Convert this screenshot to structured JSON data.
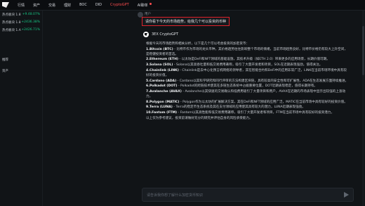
{
  "nav": {
    "items": [
      "行情",
      "资产",
      "交易",
      "理财",
      "BOC",
      "DID",
      "CryptoGPT",
      "AI聊单"
    ],
    "active": "CryptoGPT"
  },
  "sidebar": {
    "tickers": [
      {
        "name": "热点板块 1.8",
        "pct": "+9.48.07%"
      },
      {
        "name": "热点板块 1.8",
        "pct": "+2436.38%"
      },
      {
        "name": "热点板块 1.A",
        "pct": "+2426.71%"
      }
    ],
    "section_a": "推荐",
    "section_b": "资产"
  },
  "chat": {
    "user": {
      "name": "用户",
      "message": "请你看下今天的市场趋势，给我几个可以投资的币种"
    },
    "bot": {
      "name": "3EX CryptoGPT",
      "intro": "根据今天的市场趋势和相关分析，以下是几个可以考虑投资的加密货币：",
      "items": [
        {
          "title": "1.Bitcoin (BTC)",
          "text": " - 比特币作为市场的龙头币种，其价格趋势往往影响整个市场的情绪，当前市场趋势良好，比特币价格仍有较大上升空间，是稳健投资者的首选。"
        },
        {
          "title": "2.Ethereum (ETH)",
          "text": " - 以太坊是DeFi和NFT领域的基础设施，其技术升级（如ETH 2.0）带来更多的应用场景，长期价值可期。"
        },
        {
          "title": "3.Solana (SOL)",
          "text": " - Solana以其高吞吐量和低交易费用著称，吸引了大量开发者和项目，SOL在近期表现强劲，值得关注。"
        },
        {
          "title": "4.Chainlink (LINK)",
          "text": " - Chainlink是去中心化预言机网络的领导者，其在智能合约和DeFi中的应用非常广泛，LINK在当前市场环境中具有较好的投资价值。"
        },
        {
          "title": "5.Cardano (ADA)",
          "text": " - Cardano以其科学研究和同行评审的方法构建区块链，具有较高的安全性和可扩展性，ADA在生态发展方面持续推进。"
        },
        {
          "title": "6.Polkadot (DOT)",
          "text": " - Polkadot的跨链技术使其在多链生态系统中占据重要位置，DOT近期表现稳定，值得长期持有。"
        },
        {
          "title": "7.Avalanche (AVAX)",
          "text": " - Avalanche以其快速的交易确认和低费用吸引了大量项目和用户，AVAX在近期的市场表现中显示出较强的上涨动力。"
        },
        {
          "title": "8.Polygon (MATIC)",
          "text": " - Polygon作为以太坊的扩展解决方案，其在DeFi和NFT领域的应用广泛，MATIC在当前市场中具有较好的投资价值。"
        },
        {
          "title": "9.Terra (LUNA)",
          "text": " - Terra的稳定币生态系统及其在支付领域的应用使其具有较大的潜力，LUNA近期表现强劲。"
        },
        {
          "title": "10.Fantom (FTM)",
          "text": " - Fantom以其高性能和低交易费用著称，吸引了大量开发者和项目，FTM在当前市场中具有较好的投资潜力。"
        }
      ],
      "outro": "以上仅为参考建议，投资前请做好充分的研究并评估自身的风险承受能力。"
    }
  },
  "input": {
    "placeholder": "请告诉我你想了解什么加密货币知识"
  },
  "colors": {
    "accent_red": "#e0222b",
    "positive": "#16c784",
    "bg": "#111417"
  }
}
